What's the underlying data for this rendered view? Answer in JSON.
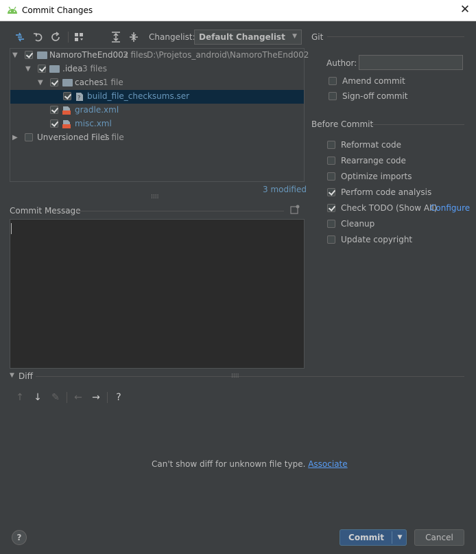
{
  "window": {
    "title": "Commit Changes",
    "close_glyph": "✕"
  },
  "toolbar": {
    "icons": [
      "show-diff-icon",
      "undo-icon",
      "refresh-icon",
      "group-by-icon",
      "expand-all-icon",
      "collapse-all-icon"
    ],
    "changelist_label": "Changelist:",
    "changelist_value": "Default Changelist"
  },
  "tree": {
    "rows": [
      {
        "name": "NamoroTheEnd002",
        "count": "3 files",
        "path": "D:\\Projetos_android\\NamoroTheEnd002"
      },
      {
        "name": ".idea",
        "count": "3 files"
      },
      {
        "name": "caches",
        "count": "1 file"
      },
      {
        "name": "build_file_checksums.ser"
      },
      {
        "name": "gradle.xml"
      },
      {
        "name": "misc.xml"
      },
      {
        "name": "Unversioned Files",
        "count": "1 file"
      }
    ],
    "modified": "3 modified"
  },
  "commit_message": {
    "label": "Commit Message",
    "value": ""
  },
  "git": {
    "section": "Git",
    "author_label": "Author:",
    "author_value": "",
    "amend": "Amend commit",
    "signoff": "Sign-off commit"
  },
  "before_commit": {
    "section": "Before Commit",
    "options": [
      {
        "label": "Reformat code",
        "checked": false
      },
      {
        "label": "Rearrange code",
        "checked": false
      },
      {
        "label": "Optimize imports",
        "checked": false
      },
      {
        "label": "Perform code analysis",
        "checked": true
      },
      {
        "label": "Check TODO (Show All)",
        "checked": true,
        "link": "Configure"
      },
      {
        "label": "Cleanup",
        "checked": false
      },
      {
        "label": "Update copyright",
        "checked": false
      }
    ]
  },
  "diff": {
    "label": "Diff",
    "message": "Can't show diff for unknown file type.",
    "link": "Associate"
  },
  "buttons": {
    "commit": "Commit",
    "cancel": "Cancel",
    "help": "?"
  },
  "colors": {
    "background": "#3c3f41",
    "selection": "#0d293e",
    "link": "#589df6",
    "primary": "#365880"
  }
}
